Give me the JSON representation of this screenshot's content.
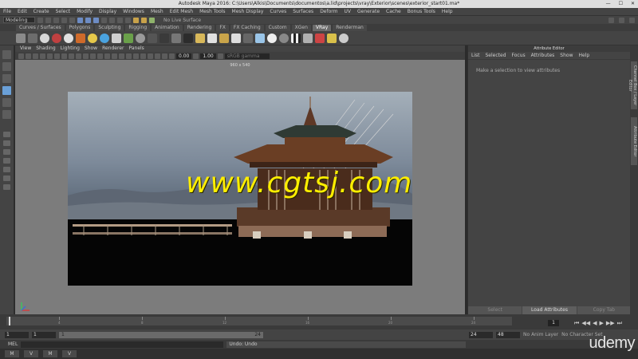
{
  "window": {
    "title": "Autodesk Maya 2016: C:\\Users\\Alkis\\Documents\\documentos\\a.lid\\projects\\vray\\Exterior\\scenes\\exterior_start01.ma*"
  },
  "menubar": [
    "File",
    "Edit",
    "Create",
    "Select",
    "Modify",
    "Display",
    "Windows",
    "Mesh",
    "Edit Mesh",
    "Mesh Tools",
    "Mesh Display",
    "Curves",
    "Surfaces",
    "Deform",
    "UV",
    "Generate",
    "Cache",
    "Bonus Tools",
    "Help"
  ],
  "status_line": {
    "mode": "Modeling",
    "live_surface": "No Live Surface"
  },
  "shelf": {
    "tabs": [
      "Curves / Surfaces",
      "Polygons",
      "Sculpting",
      "Rigging",
      "Animation",
      "Rendering",
      "FX",
      "FX Caching",
      "Custom",
      "XGen",
      "VRay",
      "Renderman"
    ],
    "active_tab": "VRay"
  },
  "viewport": {
    "menu": [
      "View",
      "Shading",
      "Lighting",
      "Show",
      "Renderer",
      "Panels"
    ],
    "near_value": "0.00",
    "far_value": "1.00",
    "color_space": "sRGB gamma",
    "resolution_gate": "960 x 540"
  },
  "watermark": "www.cgtsj.com",
  "attribute_editor": {
    "title": "Attribute Editor",
    "menu": [
      "List",
      "Selected",
      "Focus",
      "Attributes",
      "Show",
      "Help"
    ],
    "message": "Make a selection to view attributes",
    "buttons": [
      "Select",
      "Load Attributes",
      "Copy Tab"
    ],
    "side_tabs": [
      "Channel Box / Layer Editor",
      "Attribute Editor"
    ]
  },
  "timeline": {
    "ticks": [
      "1",
      "4",
      "8",
      "12",
      "16",
      "20",
      "24"
    ],
    "current_frame": "1",
    "playback_glyphs": [
      "⏮",
      "◀◀",
      "◀",
      "▶",
      "▶▶",
      "⏭"
    ]
  },
  "range": {
    "start": "1",
    "anim_start": "1",
    "slider_start": "1",
    "slider_end": "24",
    "end": "24",
    "anim_end": "48",
    "anim_layer": "No Anim Layer",
    "char_set": "No Character Set"
  },
  "command_line": {
    "label": "MEL",
    "result": "Undo: Undo"
  },
  "taskbar": {
    "items": [
      "M",
      "V",
      "M",
      "V"
    ]
  },
  "brand": "udemy",
  "colors": {
    "accent": "#6aa0d8",
    "watermark": "#ffee00",
    "viewport_bg": "#7c7c7c"
  }
}
